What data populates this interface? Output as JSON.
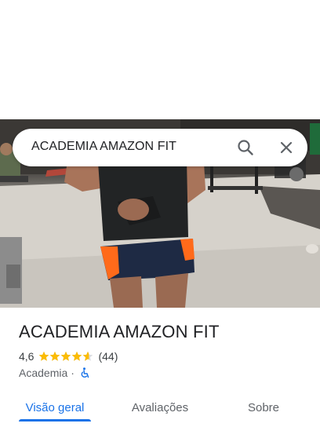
{
  "search": {
    "query": "ACADEMIA AMAZON FIT",
    "search_icon": "search-icon",
    "close_icon": "close-icon"
  },
  "photo": {
    "icon": "place-photo"
  },
  "place": {
    "title": "ACADEMIA AMAZON FIT",
    "rating": "4,6",
    "rating_numeric": 4.6,
    "stars_max": 5,
    "review_count": "(44)",
    "category": "Academia",
    "separator": "·",
    "accessibility_icon": "wheelchair-icon"
  },
  "tabs": [
    {
      "label": "Visão geral",
      "active": true
    },
    {
      "label": "Avaliações",
      "active": false
    },
    {
      "label": "Sobre",
      "active": false
    }
  ],
  "colors": {
    "accent": "#1a73e8",
    "star": "#fbbc04",
    "text_primary": "#202124",
    "text_secondary": "#5f6368"
  }
}
